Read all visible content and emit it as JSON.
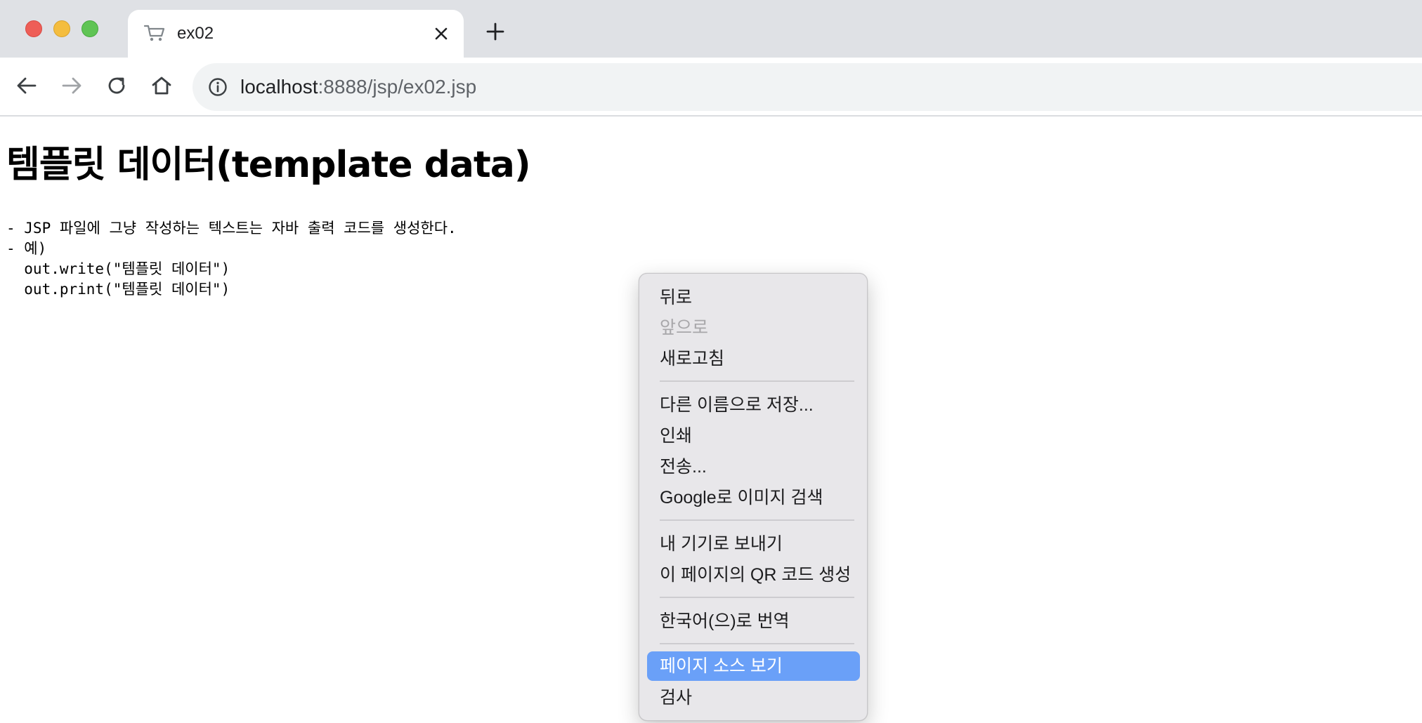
{
  "browser": {
    "tab": {
      "title": "ex02",
      "favicon": "cart-icon"
    },
    "address_bar": {
      "host": "localhost",
      "rest": ":8888/jsp/ex02.jsp"
    }
  },
  "page": {
    "heading": "템플릿 데이터(template data)",
    "lines": [
      "- JSP 파일에 그냥 작성하는 텍스트는 자바 출력 코드를 생성한다.",
      "- 예)",
      "  out.write(\"템플릿 데이터\")",
      "  out.print(\"템플릿 데이터\")"
    ]
  },
  "context_menu": {
    "items": [
      {
        "label": "뒤로",
        "enabled": true
      },
      {
        "label": "앞으로",
        "enabled": false
      },
      {
        "label": "새로고침",
        "enabled": true
      },
      {
        "label": "다른 이름으로 저장...",
        "enabled": true
      },
      {
        "label": "인쇄",
        "enabled": true
      },
      {
        "label": "전송...",
        "enabled": true
      },
      {
        "label": "Google로 이미지 검색",
        "enabled": true
      },
      {
        "label": "내 기기로 보내기",
        "enabled": true
      },
      {
        "label": "이 페이지의 QR 코드 생성",
        "enabled": true
      },
      {
        "label": "한국어(으)로 번역",
        "enabled": true
      },
      {
        "label": "페이지 소스 보기",
        "enabled": true,
        "highlighted": true
      },
      {
        "label": "검사",
        "enabled": true
      }
    ],
    "highlight_color": "#6aa0f8"
  }
}
